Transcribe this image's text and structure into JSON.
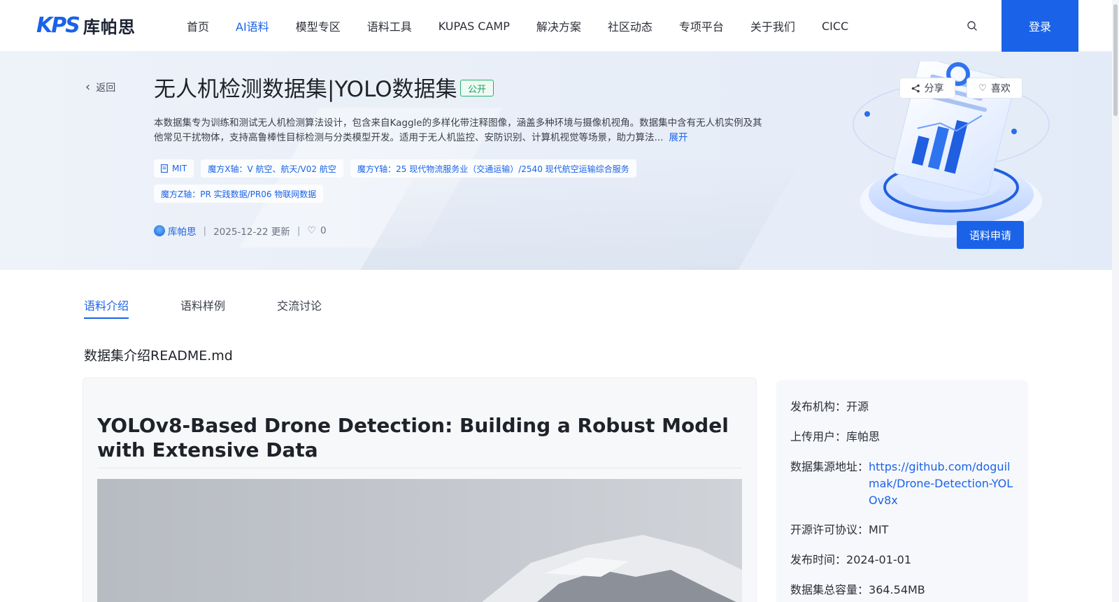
{
  "header": {
    "logo_mark": "KPS",
    "logo_text": "库帕思",
    "nav": [
      "首页",
      "AI语料",
      "模型专区",
      "语料工具",
      "KUPAS CAMP",
      "解决方案",
      "社区动态",
      "专项平台",
      "关于我们",
      "CICC"
    ],
    "active_nav": "AI语料",
    "login_label": "登录"
  },
  "hero": {
    "back_label": "返回",
    "title": "无人机检测数据集|YOLO数据集",
    "badge": "公开",
    "description": "本数据集专为训练和测试无人机检测算法设计，包含来自Kaggle的多样化带注释图像，涵盖多种环境与摄像机视角。数据集中含有无人机实例及其他常见干扰物体，支持高鲁棒性目标检测与分类模型开发。适用于无人机监控、安防识别、计算机视觉等场景，助力算法...",
    "more_label": "展开",
    "tags": [
      "MIT",
      "魔方X轴：V 航空、航天/V02 航空",
      "魔方Y轴：25 现代物流服务业（交通运输）/2540 现代航空运输综合服务",
      "魔方Z轴：PR 实践数据/PR06 物联网数据"
    ],
    "author": "库帕思",
    "updated": "2025-12-22 更新",
    "likes": "0",
    "share_label": "分享",
    "like_label": "喜欢",
    "apply_label": "语料申请"
  },
  "tabs": [
    "语料介绍",
    "语料样例",
    "交流讨论"
  ],
  "active_tab": "语料介绍",
  "section_title": "数据集介绍README.md",
  "readme": {
    "heading": "YOLOv8-Based Drone Detection: Building a Robust Model with Extensive Data"
  },
  "info": {
    "publisher_label": "发布机构：",
    "publisher": "开源",
    "uploader_label": "上传用户：",
    "uploader": "库帕思",
    "source_label": "数据集源地址：",
    "source": "https://github.com/doguilmak/Drone-Detection-YOLOv8x",
    "license_label": "开源许可协议：",
    "license": "MIT",
    "date_label": "发布时间：",
    "date": "2024-01-01",
    "size_label": "数据集总容量：",
    "size": "364.54MB"
  },
  "colors": {
    "primary": "#1a63e8",
    "badge_green": "#16a05c",
    "hero_bg": "#e8eef8"
  }
}
